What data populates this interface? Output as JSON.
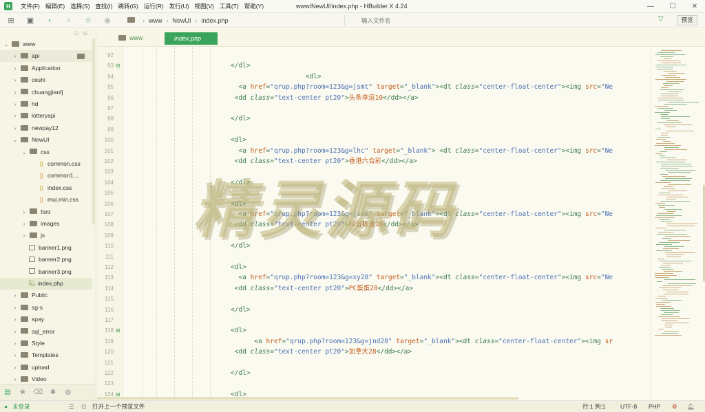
{
  "window": {
    "title": "www/NewUI/index.php - HBuilder X 4.24",
    "logo": "H"
  },
  "menu": [
    "文件(F)",
    "编辑(E)",
    "选择(S)",
    "查找(I)",
    "跳转(G)",
    "运行(R)",
    "发行(U)",
    "视图(V)",
    "工具(T)",
    "帮助(Y)"
  ],
  "toolbar": {
    "breadcrumb": [
      "www",
      "NewUI",
      "index.php"
    ],
    "search_placeholder": "输入文件名",
    "preview_label": "预览"
  },
  "sidebar": {
    "items": [
      {
        "label": "www",
        "type": "root",
        "depth": 0,
        "arrow": "⌄"
      },
      {
        "label": "api",
        "type": "folder",
        "depth": 1,
        "arrow": "›"
      },
      {
        "label": "Application",
        "type": "folder",
        "depth": 1,
        "arrow": "›"
      },
      {
        "label": "ceshi",
        "type": "folder",
        "depth": 1,
        "arrow": "›"
      },
      {
        "label": "chuangjianfj",
        "type": "folder",
        "depth": 1,
        "arrow": "›"
      },
      {
        "label": "hd",
        "type": "folder",
        "depth": 1,
        "arrow": "›"
      },
      {
        "label": "lotteryapi",
        "type": "folder",
        "depth": 1,
        "arrow": "›"
      },
      {
        "label": "newpay12",
        "type": "folder",
        "depth": 1,
        "arrow": "›"
      },
      {
        "label": "NewUI",
        "type": "folder",
        "depth": 1,
        "arrow": "⌄"
      },
      {
        "label": "css",
        "type": "folder",
        "depth": 2,
        "arrow": "⌄"
      },
      {
        "label": "common.css",
        "type": "css",
        "depth": 3,
        "arrow": ""
      },
      {
        "label": "common1....",
        "type": "css",
        "depth": 3,
        "arrow": ""
      },
      {
        "label": "index.css",
        "type": "css",
        "depth": 3,
        "arrow": ""
      },
      {
        "label": "mui.min.css",
        "type": "css",
        "depth": 3,
        "arrow": ""
      },
      {
        "label": "font",
        "type": "folder",
        "depth": 2,
        "arrow": "›"
      },
      {
        "label": "images",
        "type": "folder",
        "depth": 2,
        "arrow": "›"
      },
      {
        "label": "js",
        "type": "folder",
        "depth": 2,
        "arrow": "›"
      },
      {
        "label": "banner1.png",
        "type": "img",
        "depth": 2,
        "arrow": ""
      },
      {
        "label": "banner2.png",
        "type": "img",
        "depth": 2,
        "arrow": ""
      },
      {
        "label": "banner3.png",
        "type": "img",
        "depth": 2,
        "arrow": ""
      },
      {
        "label": "index.php",
        "type": "php",
        "depth": 2,
        "arrow": "",
        "selected": true
      },
      {
        "label": "Public",
        "type": "folder",
        "depth": 1,
        "arrow": "›"
      },
      {
        "label": "sg-s",
        "type": "folder",
        "depth": 1,
        "arrow": "›"
      },
      {
        "label": "spay",
        "type": "folder",
        "depth": 1,
        "arrow": "›"
      },
      {
        "label": "sql_error",
        "type": "folder",
        "depth": 1,
        "arrow": "›"
      },
      {
        "label": "Style",
        "type": "folder",
        "depth": 1,
        "arrow": "›"
      },
      {
        "label": "Templates",
        "type": "folder",
        "depth": 1,
        "arrow": "›"
      },
      {
        "label": "upload",
        "type": "folder",
        "depth": 1,
        "arrow": "›"
      },
      {
        "label": "Video",
        "type": "folder",
        "depth": 1,
        "arrow": "›"
      }
    ]
  },
  "tabs": {
    "folder_tab": "www",
    "active_tab": "index.php"
  },
  "editor": {
    "lines": [
      {
        "n": "92",
        "fold": "",
        "html": ""
      },
      {
        "n": "93",
        "fold": "⊟",
        "html": "<span class='tag'>&lt;/dl&gt;</span>"
      },
      {
        "n": "94",
        "fold": "",
        "html": "                   <span class='tag'>&lt;dl&gt;</span>"
      },
      {
        "n": "95",
        "fold": "",
        "html": "  <span class='tag'>&lt;a</span> <span class='attr'>href</span>=<span class='str'>\"qrup.php?room=123&amp;g=jsmt\"</span> <span class='attr'>target</span>=<span class='str'>\"_blank\"</span><span class='tag'>&gt;&lt;dt</span> <span class='kw'>class</span>=<span class='str'>\"center-float-center\"</span><span class='tag'>&gt;&lt;img</span> <span class='attr'>src</span>=<span class='str'>\"Ne</span>"
      },
      {
        "n": "96",
        "fold": "",
        "html": " <span class='tag'>&lt;dd</span> <span class='kw'>class</span>=<span class='str'>\"text-center pt20\"</span><span class='tag'>&gt;</span><span class='cn'>头条幸运10</span><span class='tag'>&lt;/dd&gt;&lt;/a&gt;</span>"
      },
      {
        "n": "97",
        "fold": "",
        "html": ""
      },
      {
        "n": "98",
        "fold": "",
        "html": "<span class='tag'>&lt;/dl&gt;</span>"
      },
      {
        "n": "99",
        "fold": "",
        "html": ""
      },
      {
        "n": "100",
        "fold": "",
        "html": "<span class='tag'>&lt;dl&gt;</span>"
      },
      {
        "n": "101",
        "fold": "",
        "html": "  <span class='tag'>&lt;a</span> <span class='attr'>href</span>=<span class='str'>\"qrup.php?room=123&amp;g=lhc\"</span> <span class='attr'>target</span>=<span class='str'>\"_blank\"</span><span class='tag'>&gt; &lt;dt</span> <span class='kw'>class</span>=<span class='str'>\"center-float-center\"</span><span class='tag'>&gt;&lt;img</span> <span class='attr'>src</span>=<span class='str'>\"Ne</span>"
      },
      {
        "n": "102",
        "fold": "",
        "html": " <span class='tag'>&lt;dd</span> <span class='kw'>class</span>=<span class='str'>\"text-center pt20\"</span><span class='tag'>&gt;</span><span class='cn'>香港六合彩</span><span class='tag'>&lt;/dd&gt;&lt;/a&gt;</span>"
      },
      {
        "n": "103",
        "fold": "",
        "html": ""
      },
      {
        "n": "104",
        "fold": "",
        "html": "<span class='tag'>&lt;/dl&gt;</span>"
      },
      {
        "n": "105",
        "fold": "",
        "html": ""
      },
      {
        "n": "106",
        "fold": "",
        "html": "<span class='tag'>&lt;dl&gt;</span>"
      },
      {
        "n": "107",
        "fold": "",
        "html": "  <span class='tag'>&lt;a</span> <span class='attr'>href</span>=<span class='str'>\"qrup.php?room=123&amp;g=jssm\"</span> <span class='attr'>target</span>=<span class='str'>\"_blank\"</span><span class='tag'>&gt;&lt;dt</span> <span class='kw'>class</span>=<span class='str'>\"center-float-center\"</span><span class='tag'>&gt;&lt;img</span> <span class='attr'>src</span>=<span class='str'>\"Ne</span>"
      },
      {
        "n": "108",
        "fold": "",
        "html": " <span class='tag'>&lt;dd</span> <span class='kw'>class</span>=<span class='str'>\"text-center pt20\"</span><span class='tag'>&gt;</span><span class='cn'>抖音极速10</span><span class='tag'>&lt;/dd&gt;&lt;/a&gt;</span>"
      },
      {
        "n": "109",
        "fold": "",
        "html": ""
      },
      {
        "n": "110",
        "fold": "",
        "html": "<span class='tag'>&lt;/dl&gt;</span>"
      },
      {
        "n": "111",
        "fold": "",
        "html": ""
      },
      {
        "n": "112",
        "fold": "",
        "html": "<span class='tag'>&lt;dl&gt;</span>"
      },
      {
        "n": "113",
        "fold": "",
        "html": "  <span class='tag'>&lt;a</span> <span class='attr'>href</span>=<span class='str'>\"qrup.php?room=123&amp;g=xy28\"</span> <span class='attr'>target</span>=<span class='str'>\"_blank\"</span><span class='tag'>&gt;&lt;dt</span> <span class='kw'>class</span>=<span class='str'>\"center-float-center\"</span><span class='tag'>&gt;&lt;img</span> <span class='attr'>src</span>=<span class='str'>\"Ne</span>"
      },
      {
        "n": "114",
        "fold": "",
        "html": " <span class='tag'>&lt;dd</span> <span class='kw'>class</span>=<span class='str'>\"text-center pt20\"</span><span class='tag'>&gt;</span><span class='cn'>PC蛋蛋28</span><span class='tag'>&lt;/dd&gt;&lt;/a&gt;</span>"
      },
      {
        "n": "115",
        "fold": "",
        "html": ""
      },
      {
        "n": "116",
        "fold": "",
        "html": "<span class='tag'>&lt;/dl&gt;</span>"
      },
      {
        "n": "117",
        "fold": "",
        "html": ""
      },
      {
        "n": "118",
        "fold": "⊟",
        "html": "<span class='tag'>&lt;dl&gt;</span>"
      },
      {
        "n": "119",
        "fold": "",
        "html": "      <span class='tag'>&lt;a</span> <span class='attr'>href</span>=<span class='str'>\"qrup.php?room=123&amp;g=jnd28\"</span> <span class='attr'>target</span>=<span class='str'>\"_blank\"</span><span class='tag'>&gt;&lt;dt</span> <span class='kw'>class</span>=<span class='str'>\"center-float-center\"</span><span class='tag'>&gt;&lt;img</span> <span class='attr'>sr</span>"
      },
      {
        "n": "120",
        "fold": "",
        "html": " <span class='tag'>&lt;dd</span> <span class='kw'>class</span>=<span class='str'>\"text-center pt20\"</span><span class='tag'>&gt;</span><span class='cn'>加拿大28</span><span class='tag'>&lt;/dd&gt;&lt;/a&gt;</span>"
      },
      {
        "n": "121",
        "fold": "",
        "html": ""
      },
      {
        "n": "122",
        "fold": "",
        "html": "<span class='tag'>&lt;/dl&gt;</span>"
      },
      {
        "n": "123",
        "fold": "",
        "html": ""
      },
      {
        "n": "124",
        "fold": "⊟",
        "html": "<span class='tag'>&lt;dl&gt;</span>"
      }
    ],
    "watermark": "精灵源码"
  },
  "statusbar": {
    "login": "未登录",
    "hint": "打开上一个预览文件",
    "position": "行:1  列:1",
    "encoding": "UTF-8",
    "language": "PHP"
  },
  "colors": {
    "accent": "#3aa55a",
    "sidebar_bg": "#f6f5e6",
    "editor_bg": "#fafaf0"
  }
}
